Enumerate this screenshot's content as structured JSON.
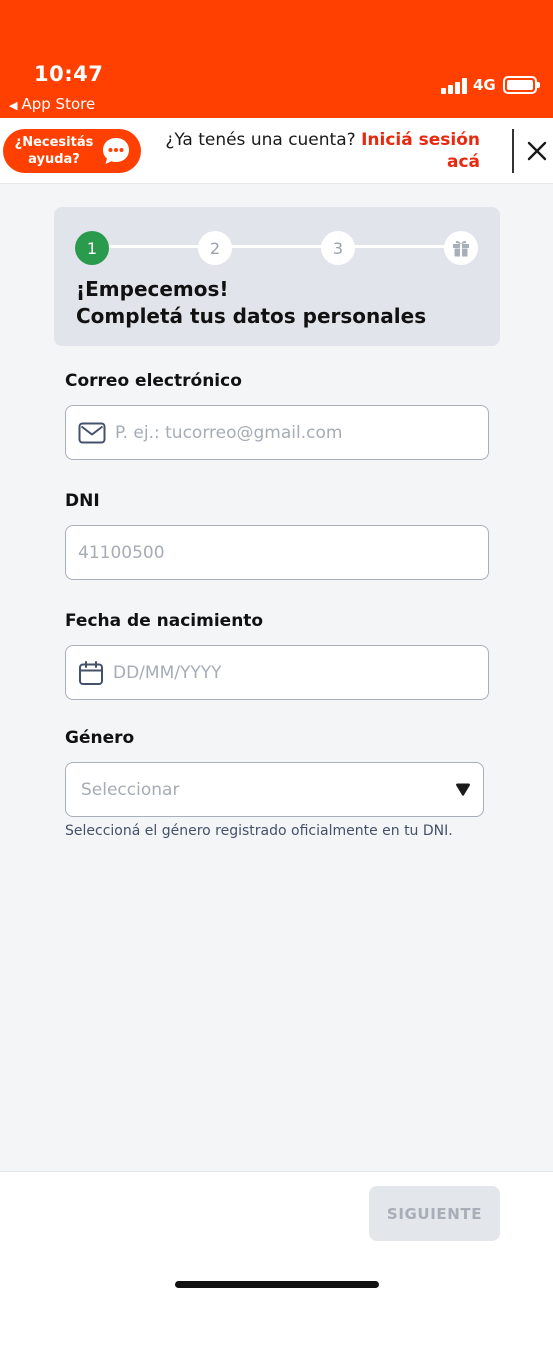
{
  "status_bar": {
    "time": "10:47",
    "back_label": "App Store",
    "network": "4G",
    "icons": [
      "signal-icon",
      "battery-icon"
    ]
  },
  "banner": {
    "help_label": "¿Necesitás ayuda?",
    "login_prompt": "¿Ya tenés una cuenta?",
    "login_link": "Iniciá sesión acá",
    "icons": [
      "chat-bubble-icon",
      "close-icon"
    ]
  },
  "stepper": {
    "steps": [
      "1",
      "2",
      "3"
    ],
    "final_step_icon": "gift-icon",
    "active_step": 1,
    "title_line1": "¡Empecemos!",
    "title_line2": "Completá tus datos personales"
  },
  "form": {
    "email": {
      "label": "Correo electrónico",
      "placeholder": "P. ej.: tucorreo@gmail.com",
      "icon": "mail-icon"
    },
    "dni": {
      "label": "DNI",
      "placeholder": "41100500"
    },
    "birthdate": {
      "label": "Fecha de nacimiento",
      "placeholder": "DD/MM/YYYY",
      "icon": "calendar-icon"
    },
    "gender": {
      "label": "Género",
      "placeholder": "Seleccionar",
      "hint": "Seleccioná el género registrado oficialmente en tu DNI.",
      "icon": "caret-down-icon"
    }
  },
  "footer": {
    "next_label": "SIGUIENTE"
  },
  "colors": {
    "brand": "#ff4000",
    "link": "#e8280f",
    "step_active": "#2a9a4d",
    "page_bg": "#f4f5f7"
  }
}
